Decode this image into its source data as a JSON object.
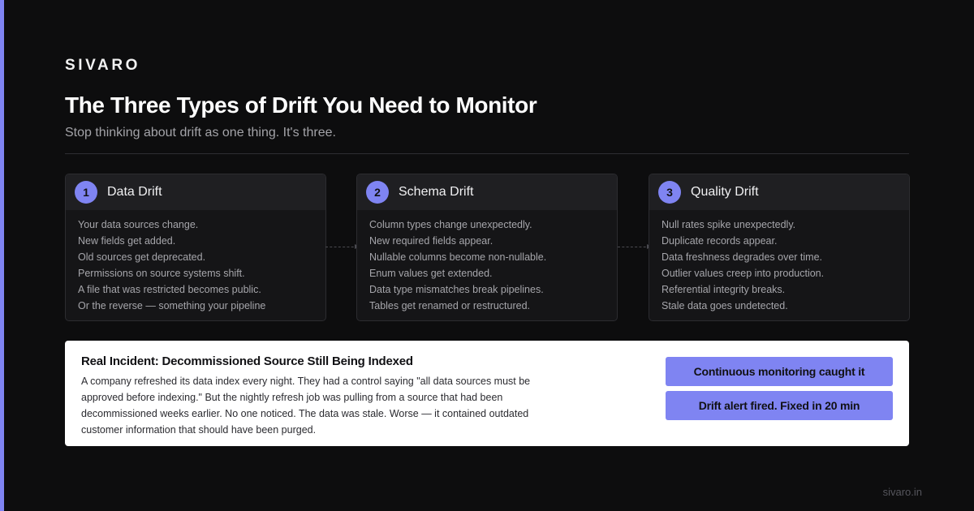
{
  "brand": "SIVARO",
  "title": "The Three Types of Drift You Need to Monitor",
  "subtitle": "Stop thinking about drift as one thing. It's three.",
  "cards": [
    {
      "number": "1",
      "title": "Data Drift",
      "lines": [
        "Your data sources change.",
        "New fields get added.",
        "Old sources get deprecated.",
        "Permissions on source systems shift.",
        "A file that was restricted becomes public.",
        "Or the reverse — something your pipeline"
      ]
    },
    {
      "number": "2",
      "title": "Schema Drift",
      "lines": [
        "Column types change unexpectedly.",
        "New required fields appear.",
        "Nullable columns become non-nullable.",
        "Enum values get extended.",
        "Data type mismatches break pipelines.",
        "Tables get renamed or restructured."
      ]
    },
    {
      "number": "3",
      "title": "Quality Drift",
      "lines": [
        "Null rates spike unexpectedly.",
        "Duplicate records appear.",
        "Data freshness degrades over time.",
        "Outlier values creep into production.",
        "Referential integrity breaks.",
        "Stale data goes undetected."
      ]
    }
  ],
  "incident": {
    "title": "Real Incident: Decommissioned Source Still Being Indexed",
    "lines": [
      "A company refreshed its data index every night. They had a control saying \"all data sources must be",
      "approved before indexing.\" But the nightly refresh job was pulling from a source that had been",
      "decommissioned weeks earlier. No one noticed. The data was stale. Worse — it contained outdated",
      "customer information that should have been purged."
    ],
    "outcomes": [
      "Continuous monitoring caught it",
      "Drift alert fired. Fixed in 20 min"
    ]
  },
  "footer": {
    "url": "sivaro.in"
  },
  "colors": {
    "accent": "#7f84f2",
    "background": "#0d0d0e",
    "card_bg": "#151517",
    "card_header_bg": "#1f1f22",
    "incident_bg": "#ffffff"
  }
}
